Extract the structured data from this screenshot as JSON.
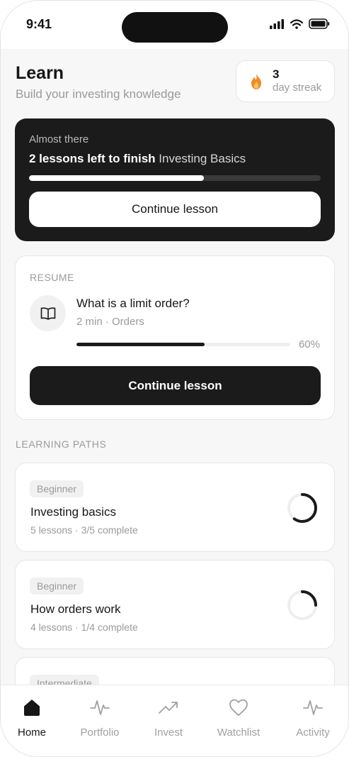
{
  "status_bar": {
    "time": "9:41"
  },
  "header": {
    "title": "Learn",
    "subtitle": "Build your investing knowledge",
    "streak": {
      "count": "3",
      "label": "day streak",
      "icon": "flame-icon"
    }
  },
  "goal_card": {
    "eyebrow": "Almost there",
    "headline_bold": "2 lessons left to finish",
    "course_name": "Investing Basics",
    "progress": 0.6,
    "button_label": "Continue lesson"
  },
  "resume_card": {
    "eyebrow": "RESUME",
    "icon": "book-icon",
    "lesson_title": "What is a limit order?",
    "lesson_meta": "2 min · Orders",
    "progress": 0.6,
    "progress_label": "60%",
    "button_label": "Continue lesson"
  },
  "learning_paths": {
    "section_label": "LEARNING PATHS",
    "items": [
      {
        "level": "Beginner",
        "title": "Investing basics",
        "meta": "5 lessons · 3/5 complete",
        "progress": 0.6
      },
      {
        "level": "Beginner",
        "title": "How orders work",
        "meta": "4 lessons · 1/4 complete",
        "progress": 0.25
      },
      {
        "level": "Intermediate",
        "title": "",
        "meta": "",
        "progress": 0
      }
    ]
  },
  "tabbar": {
    "items": [
      {
        "label": "Home",
        "icon": "home-icon",
        "active": true
      },
      {
        "label": "Portfolio",
        "icon": "pulse-icon",
        "active": false
      },
      {
        "label": "Invest",
        "icon": "trending-up-icon",
        "active": false
      },
      {
        "label": "Watchlist",
        "icon": "heart-icon",
        "active": false
      },
      {
        "label": "Activity",
        "icon": "activity-icon",
        "active": false
      }
    ]
  },
  "colors": {
    "dark": "#1b1b1c",
    "muted": "#9a9a9a",
    "flame": "#f08a24"
  }
}
